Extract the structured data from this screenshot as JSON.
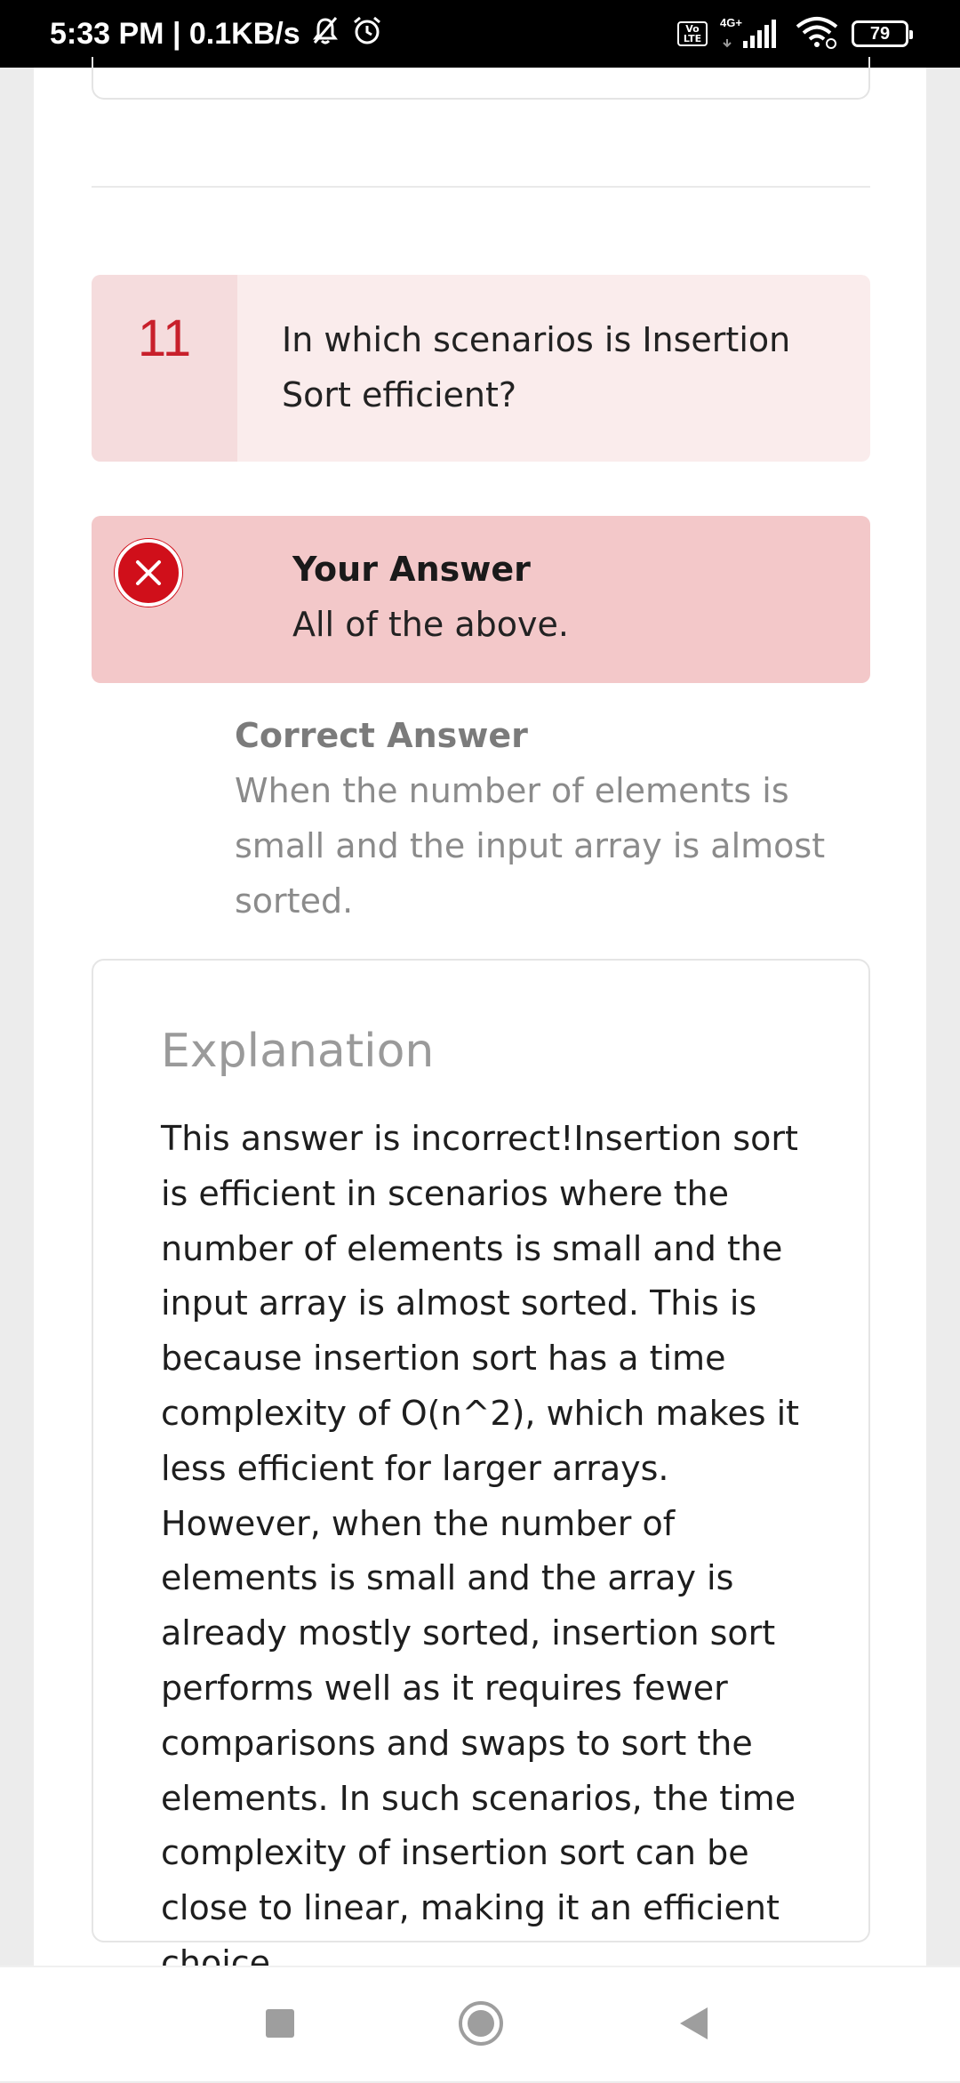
{
  "status": {
    "time_speed": "5:33 PM | 0.1KB/s",
    "network": "4G+",
    "volte_top": "Vo",
    "volte_bottom": "LTE",
    "battery": "79"
  },
  "question": {
    "number": "11",
    "text": "In which scenarios is Insertion Sort efficient?"
  },
  "your_answer": {
    "title": "Your Answer",
    "text": "All of the above."
  },
  "correct_answer": {
    "title": "Correct Answer",
    "text": "When the number of elements is small and the input array is almost sorted."
  },
  "explanation": {
    "title": "Explanation",
    "text": "This answer is incorrect!Insertion sort is efficient in scenarios where the number of elements is small and the input array is almost sorted. This is because insertion sort has a time complexity of O(n^2), which makes it less efficient for larger arrays. However, when the number of elements is small and the array is already mostly sorted, insertion sort performs well as it requires fewer comparisons and swaps to sort the elements. In such scenarios, the time complexity of insertion sort can be close to linear, making it an efficient choice."
  },
  "colors": {
    "accent_red": "#d00f1a",
    "number_red": "#c8202b",
    "question_bg": "#faecec",
    "answer_bg": "#f3c8c9"
  },
  "icons": {
    "status": [
      "mute-bell-icon",
      "alarm-icon",
      "signal-icon",
      "wifi-icon",
      "battery-icon"
    ],
    "answer": "close-circle-icon",
    "nav": [
      "recents-icon",
      "home-icon",
      "back-icon"
    ]
  }
}
